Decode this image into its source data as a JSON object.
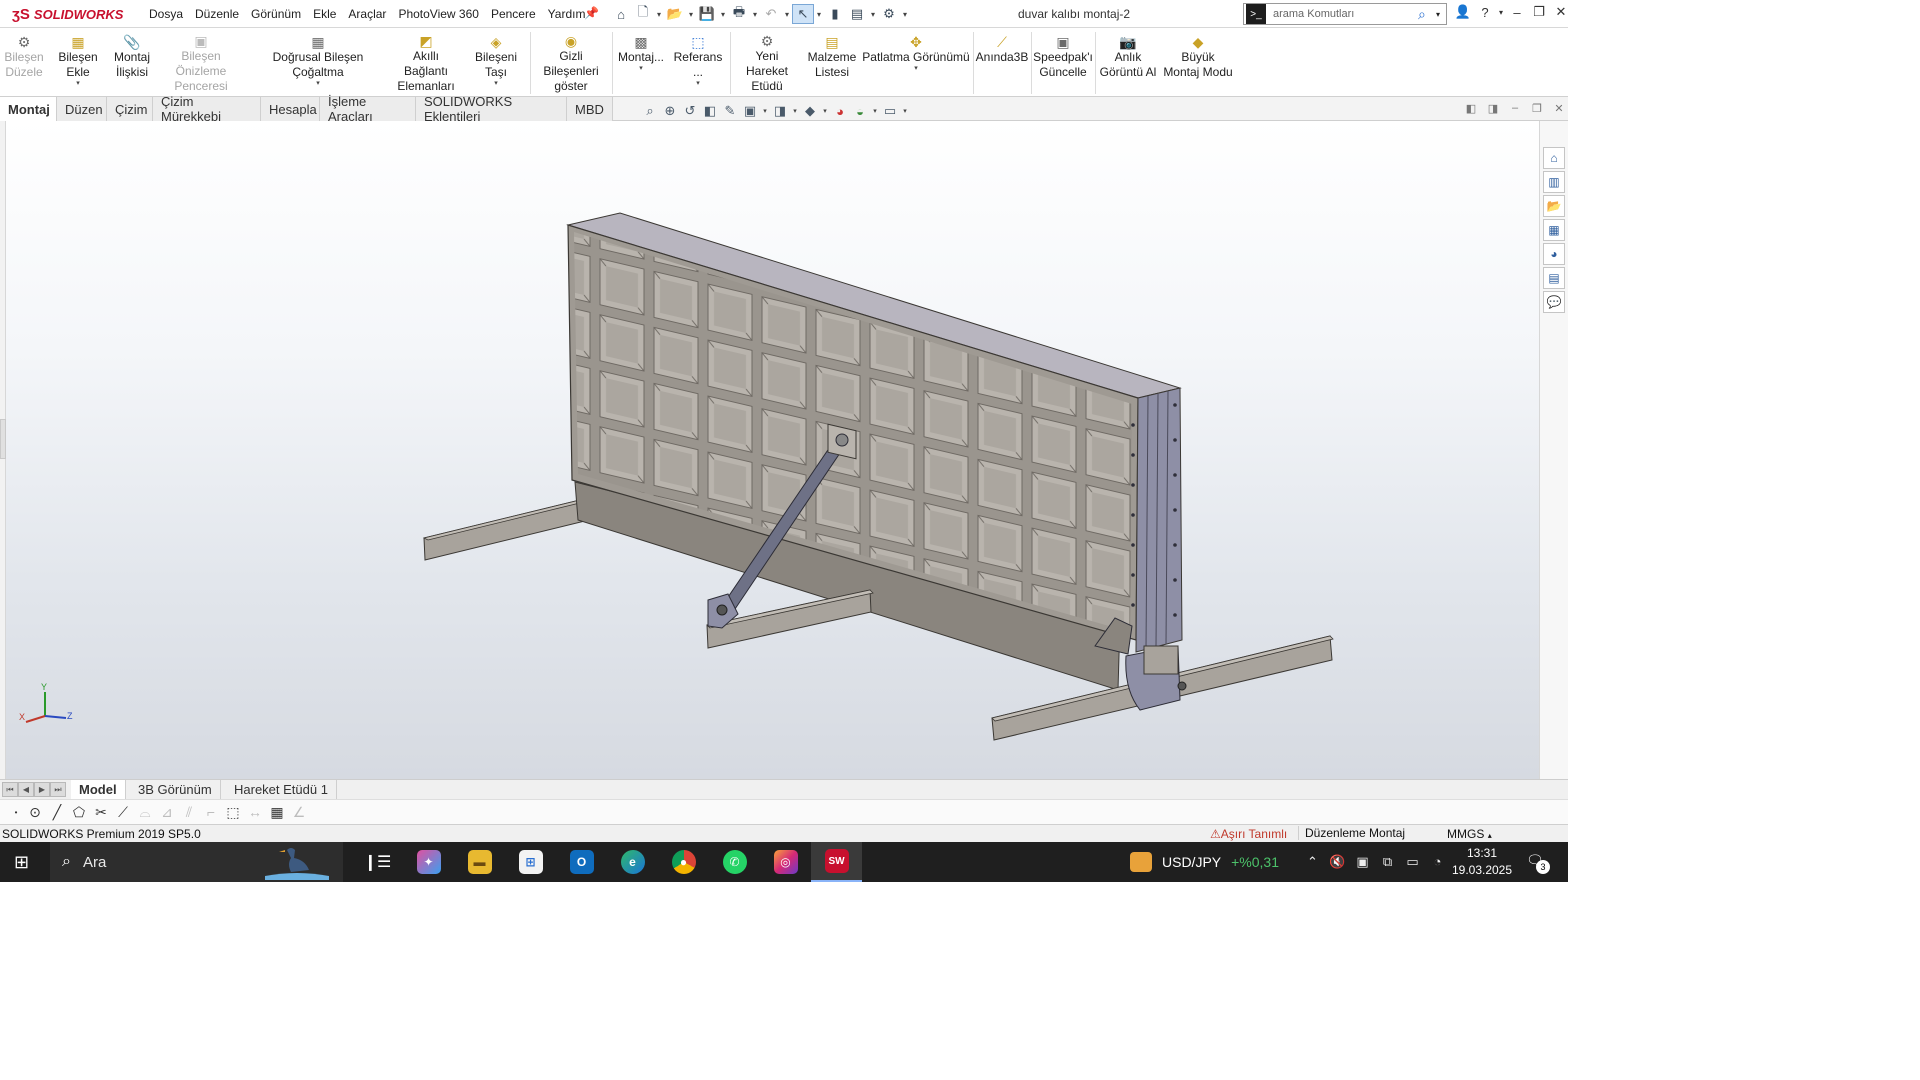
{
  "app": {
    "logo": "SOLIDWORKS",
    "doc_title": "duvar kalıbı montaj-2"
  },
  "menu": [
    "Dosya",
    "Düzenle",
    "Görünüm",
    "Ekle",
    "Araçlar",
    "PhotoView 360",
    "Pencere",
    "Yardım"
  ],
  "search": {
    "placeholder": "arama Komutları"
  },
  "ribbon": {
    "bilesen_duzele": [
      "Bileşen",
      "Düzele"
    ],
    "bilesen_ekle": "Bileşen Ekle",
    "montaj_iliskisi": [
      "Montaj",
      "İlişkisi"
    ],
    "bilesen_onizleme": [
      "Bileşen Önizleme",
      "Penceresi"
    ],
    "dogrusal": "Doğrusal Bileşen Çoğaltma",
    "akilli": [
      "Akıllı Bağlantı",
      "Elemanları"
    ],
    "bileseni_tasi": "Bileşeni Taşı",
    "gizli": [
      "Gizli Bileşenleri",
      "göster"
    ],
    "montaj_dd": "Montaj...",
    "referans": "Referans ...",
    "yeni_hareket": [
      "Yeni Hareket",
      "Etüdü"
    ],
    "malzeme": [
      "Malzeme",
      "Listesi"
    ],
    "patlatma": "Patlatma Görünümü",
    "aninda3b": "Anında3B",
    "speedpak": [
      "Speedpak'ı",
      "Güncelle"
    ],
    "anlik": [
      "Anlık",
      "Görüntü Al"
    ],
    "buyuk": [
      "Büyük",
      "Montaj Modu"
    ]
  },
  "tabs": [
    "Montaj",
    "Düzen",
    "Çizim",
    "Çizim Mürekkebi",
    "Hesapla",
    "İşleme Araçları",
    "SOLIDWORKS Eklentileri",
    "MBD"
  ],
  "axes": {
    "x": "X",
    "y": "Y",
    "z": "Z"
  },
  "bottom_tabs": [
    "Model",
    "3B Görünüm",
    "Hareket Etüdü 1"
  ],
  "status": {
    "product": "SOLIDWORKS Premium 2019 SP5.0",
    "warning": "Aşırı Tanımlı",
    "mode": "Düzenleme Montaj",
    "units": "MMGS"
  },
  "taskbar": {
    "search": "Ara",
    "usd_label": "USD/JPY",
    "usd_change": "+%0,31",
    "time": "13:31",
    "date": "19.03.2025",
    "notifications": "3",
    "app_badge": "SW"
  },
  "colors": {
    "accent": "#2a6fd1",
    "brand": "#c8102e",
    "warning": "#c0392b",
    "positive": "#4cc26a"
  }
}
